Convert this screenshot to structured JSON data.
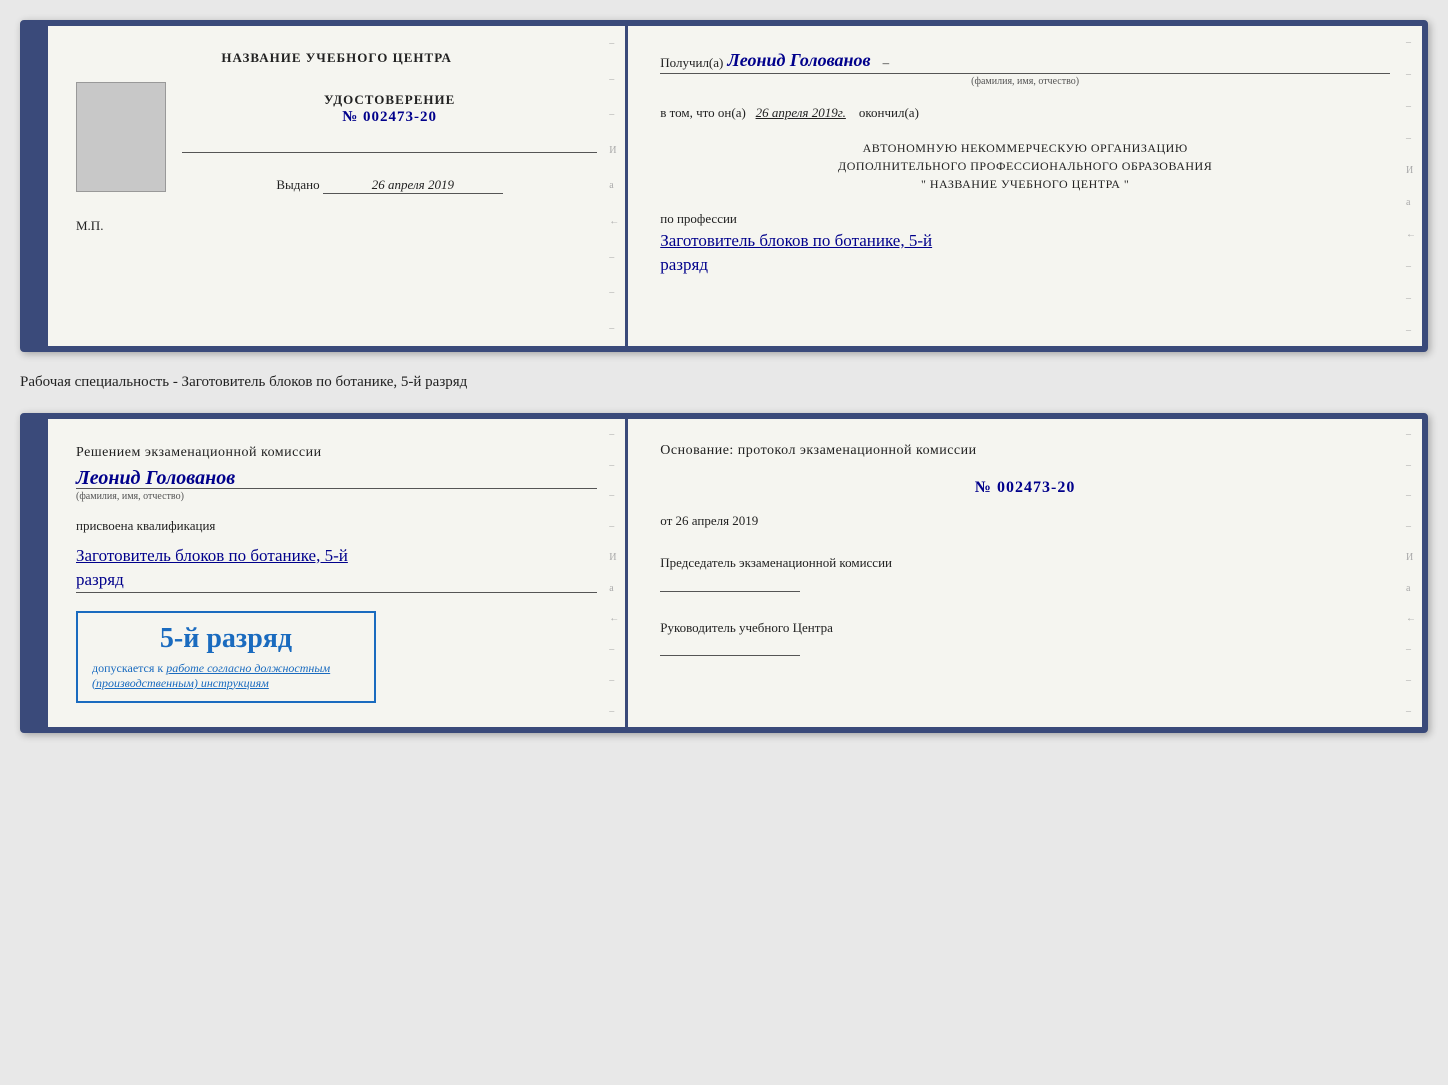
{
  "top_card": {
    "left": {
      "title": "НАЗВАНИЕ УЧЕБНОГО ЦЕНТРА",
      "cert_label": "УДОСТОВЕРЕНИЕ",
      "cert_number_prefix": "№",
      "cert_number": "002473-20",
      "issued_label": "Выдано",
      "issued_date": "26 апреля 2019",
      "mp_label": "М.П."
    },
    "right": {
      "received_prefix": "Получил(а)",
      "recipient_name": "Леонид Голованов",
      "fio_caption": "(фамилия, имя, отчество)",
      "date_prefix": "в том, что он(а)",
      "date_value": "26 апреля 2019г.",
      "date_suffix": "окончил(а)",
      "org_line1": "АВТОНОМНУЮ НЕКОММЕРЧЕСКУЮ ОРГАНИЗАЦИЮ",
      "org_line2": "ДОПОЛНИТЕЛЬНОГО ПРОФЕССИОНАЛЬНОГО ОБРАЗОВАНИЯ",
      "org_line3": "\"   НАЗВАНИЕ УЧЕБНОГО ЦЕНТРА   \"",
      "profession_prefix": "по профессии",
      "profession_name": "Заготовитель блоков по ботанике, 5-й",
      "razryad_value": "разряд"
    }
  },
  "specialty_label": "Рабочая специальность - Заготовитель блоков по ботанике, 5-й разряд",
  "bottom_card": {
    "left": {
      "commission_intro": "Решением экзаменационной комиссии",
      "person_name": "Леонид Голованов",
      "fio_caption": "(фамилия, имя, отчество)",
      "assigned_label": "присвоена квалификация",
      "profession_name": "Заготовитель блоков по ботанике, 5-й",
      "razryad_value": "разряд",
      "stamp_grade": "5-й разряд",
      "stamp_allowed_prefix": "допускается к",
      "stamp_allowed_value": "работе согласно должностным",
      "stamp_allowed_suffix": "(производственным) инструкциям"
    },
    "right": {
      "osnov_label": "Основание: протокол экзаменационной комиссии",
      "protokol_number_prefix": "№",
      "protokol_number": "002473-20",
      "protokol_date_prefix": "от",
      "protokol_date": "26 апреля 2019",
      "chairman_label": "Председатель экзаменационной комиссии",
      "head_label": "Руководитель учебного Центра"
    }
  }
}
